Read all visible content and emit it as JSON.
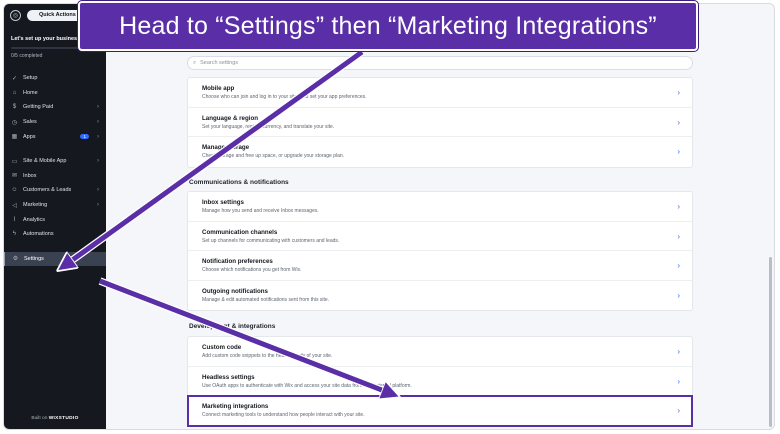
{
  "banner": {
    "text": "Head to “Settings” then “Marketing Integrations”"
  },
  "sidebar": {
    "quick_actions": "Quick Actions",
    "setup_title": "Let's set up your business",
    "setup_progress": "0/5 completed",
    "setup_fraction": 0,
    "items": [
      {
        "label": "Setup",
        "icon": "setup-icon",
        "chevron": false
      },
      {
        "label": "Home",
        "icon": "home-icon",
        "chevron": false
      },
      {
        "label": "Getting Paid",
        "icon": "payment-icon",
        "chevron": true
      },
      {
        "label": "Sales",
        "icon": "sales-icon",
        "chevron": true
      },
      {
        "label": "Apps",
        "icon": "apps-icon",
        "chevron": true,
        "badge": "1"
      },
      {
        "label": "Site & Mobile App",
        "icon": "site-icon",
        "chevron": true
      },
      {
        "label": "Inbox",
        "icon": "inbox-icon",
        "chevron": false
      },
      {
        "label": "Customers & Leads",
        "icon": "customers-icon",
        "chevron": true
      },
      {
        "label": "Marketing",
        "icon": "marketing-icon",
        "chevron": true
      },
      {
        "label": "Analytics",
        "icon": "analytics-icon",
        "chevron": false
      },
      {
        "label": "Automations",
        "icon": "automations-icon",
        "chevron": false
      },
      {
        "label": "Settings",
        "icon": "gear-icon",
        "chevron": false,
        "active": true
      }
    ],
    "built_on": "Built on",
    "built_brand": "WIXSTUDIO"
  },
  "search": {
    "placeholder": "Search settings"
  },
  "group1": [
    {
      "title": "Mobile app",
      "desc": "Choose who can join and log in to your site, and set your app preferences."
    },
    {
      "title": "Language & region",
      "desc": "Set your language, region, currency, and translate your site."
    },
    {
      "title": "Manage storage",
      "desc": "Check storage and free up space, or upgrade your storage plan."
    }
  ],
  "section_comm": "Communications & notifications",
  "group2": [
    {
      "title": "Inbox settings",
      "desc": "Manage how you send and receive Inbox messages."
    },
    {
      "title": "Communication channels",
      "desc": "Set up channels for communicating with customers and leads."
    },
    {
      "title": "Notification preferences",
      "desc": "Choose which notifications you get from Wix."
    },
    {
      "title": "Outgoing notifications",
      "desc": "Manage & edit automated notifications sent from this site."
    }
  ],
  "section_dev": "Development & integrations",
  "group3": [
    {
      "title": "Custom code",
      "desc": "Add custom code snippets to the head or body of your site."
    },
    {
      "title": "Headless settings",
      "desc": "Use OAuth apps to authenticate with Wix and access your site data from any external platform."
    },
    {
      "title": "Marketing integrations",
      "desc": "Connect marketing tools to understand how people interact with your site.",
      "highlight": true
    }
  ],
  "colors": {
    "accent": "#5a2ea6",
    "sidebar_bg": "#15191f",
    "link_chevron": "#3b6cf5"
  }
}
